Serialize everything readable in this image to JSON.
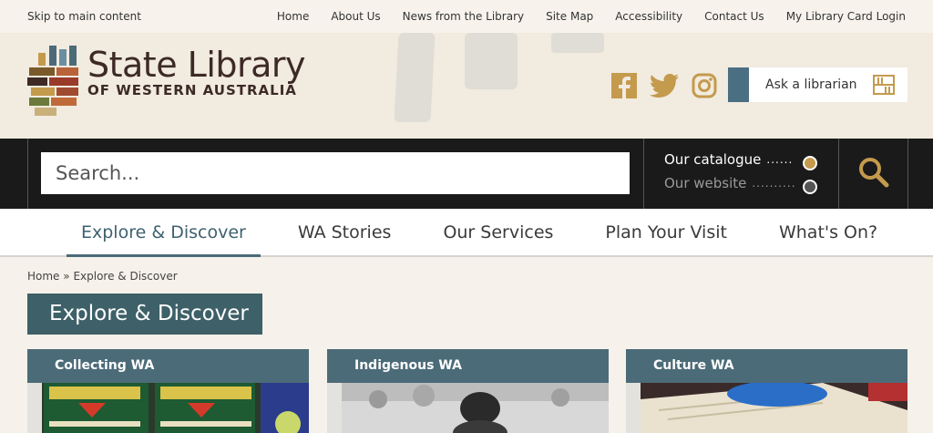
{
  "topbar": {
    "skip": "Skip to main content",
    "links": [
      "Home",
      "About Us",
      "News from the Library",
      "Site Map",
      "Accessibility",
      "Contact Us",
      "My Library Card Login"
    ]
  },
  "logo": {
    "title": "State Library",
    "subtitle": "OF WESTERN AUSTRALIA"
  },
  "header": {
    "social_icons": [
      "facebook-icon",
      "twitter-icon",
      "instagram-icon"
    ],
    "ask_label": "Ask a librarian"
  },
  "search": {
    "placeholder": "Search...",
    "scopes": [
      {
        "label": "Our catalogue",
        "selected": true
      },
      {
        "label": "Our website",
        "selected": false
      }
    ]
  },
  "mainnav": {
    "items": [
      "Explore & Discover",
      "WA Stories",
      "Our Services",
      "Plan Your Visit",
      "What's On?"
    ],
    "active": "Explore & Discover"
  },
  "breadcrumb": {
    "home": "Home",
    "separator": "»",
    "current": "Explore & Discover"
  },
  "page": {
    "title": "Explore & Discover"
  },
  "cards": [
    {
      "title": "Collecting WA"
    },
    {
      "title": "Indigenous WA"
    },
    {
      "title": "Culture WA"
    }
  ],
  "colors": {
    "accent_gold": "#c49a4d",
    "teal": "#4c6b78",
    "dark": "#1a1a1a"
  }
}
